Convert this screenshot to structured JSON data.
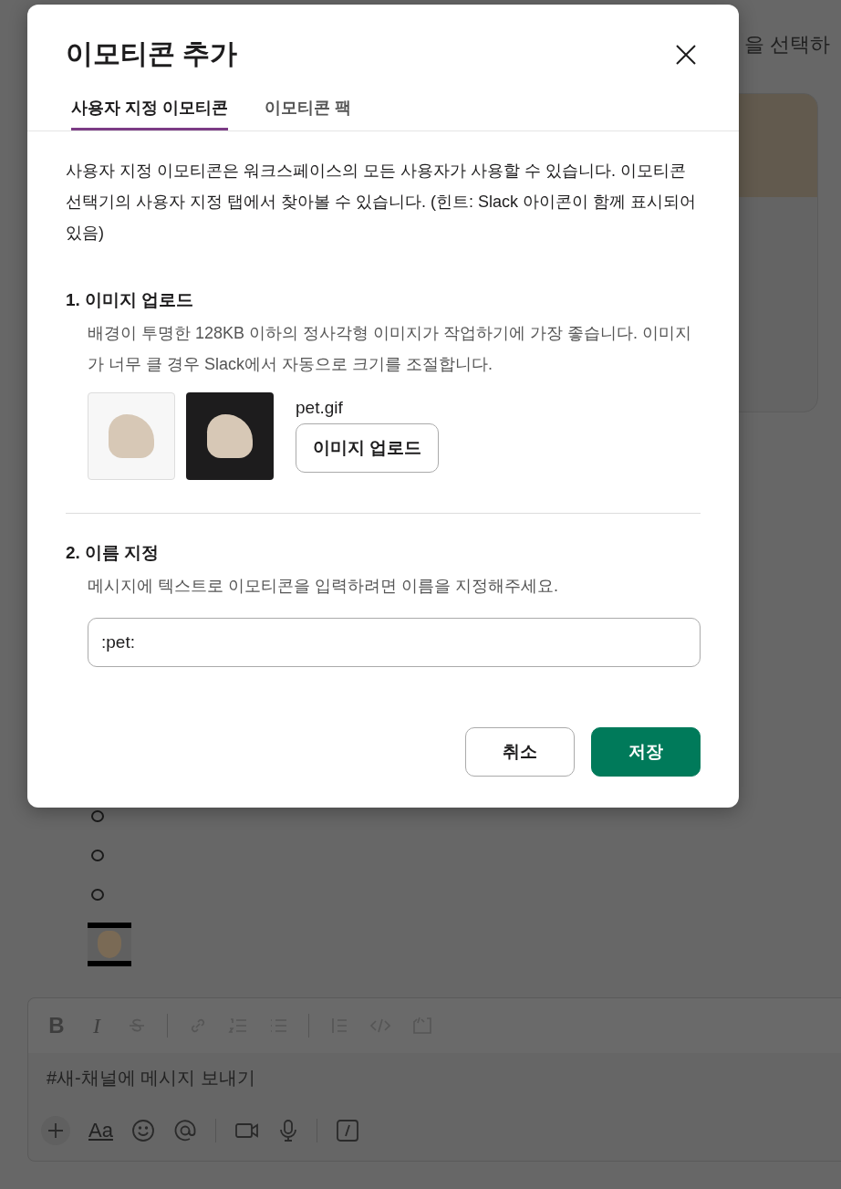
{
  "background": {
    "header_text": "을 선택하",
    "list_items": [
      {
        "kind": "empty"
      },
      {
        "kind": "empty"
      },
      {
        "kind": "empty"
      }
    ],
    "composer": {
      "toolbar": [
        {
          "kind": "bold",
          "glyph": "B"
        },
        {
          "kind": "italic",
          "glyph": "I"
        },
        {
          "kind": "strike"
        },
        {
          "kind": "sep"
        },
        {
          "kind": "link"
        },
        {
          "kind": "ol"
        },
        {
          "kind": "ul"
        },
        {
          "kind": "sep"
        },
        {
          "kind": "quote"
        },
        {
          "kind": "code"
        },
        {
          "kind": "codeblock"
        }
      ],
      "placeholder": "#새-채널에 메시지 보내기",
      "actions": [
        {
          "kind": "plus"
        },
        {
          "kind": "format",
          "glyph": "Aa"
        },
        {
          "kind": "emoji"
        },
        {
          "kind": "mention"
        },
        {
          "kind": "sep"
        },
        {
          "kind": "video"
        },
        {
          "kind": "mic"
        },
        {
          "kind": "sep"
        },
        {
          "kind": "slash"
        }
      ]
    }
  },
  "dialog": {
    "title": "이모티콘 추가",
    "tabs": [
      {
        "label": "사용자 지정 이모티콘",
        "selected": true
      },
      {
        "label": "이모티콘 팩",
        "selected": false
      }
    ],
    "description": "사용자 지정 이모티콘은 워크스페이스의 모든 사용자가 사용할 수 있습니다. 이모티콘 선택기의 사용자 지정 탭에서 찾아볼 수 있습니다. (힌트: Slack 아이콘이 함께 표시되어 있음)",
    "upload": {
      "heading": "1. 이미지 업로드",
      "hint": "배경이 투명한 128KB 이하의 정사각형 이미지가 작업하기에 가장 좋습니다. 이미지가 너무 클 경우 Slack에서 자동으로 크기를 조절합니다.",
      "file_name": "pet.gif",
      "button": "이미지 업로드"
    },
    "name": {
      "heading": "2. 이름 지정",
      "hint": "메시지에 텍스트로 이모티콘을 입력하려면 이름을 지정해주세요.",
      "value": ":pet:"
    },
    "buttons": [
      {
        "label": "취소",
        "kind": "secondary"
      },
      {
        "label": "저장",
        "kind": "primary"
      }
    ]
  }
}
